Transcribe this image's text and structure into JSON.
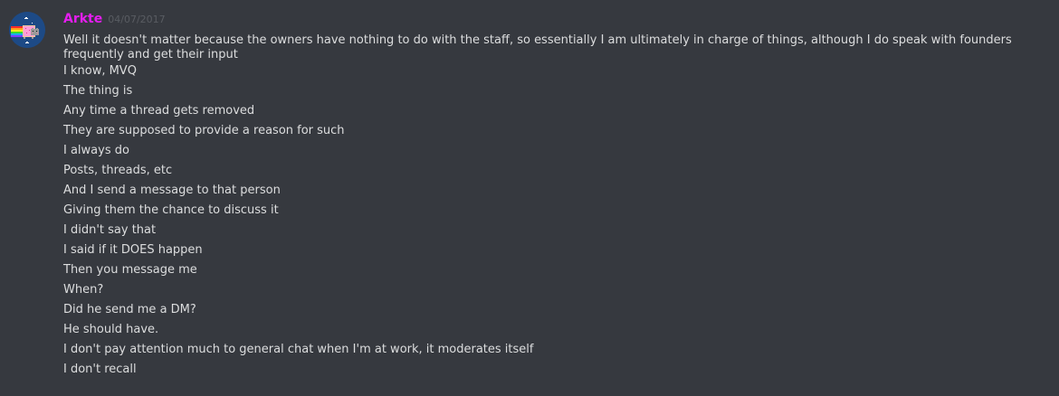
{
  "message": {
    "author": "Arkte",
    "timestamp": "04/07/2017",
    "author_color": "#e51eef",
    "avatar_icon": "nyan-cat-avatar"
  },
  "lines": [
    "Well it doesn't matter because the owners have nothing to do with the staff, so essentially I am ultimately in charge of things, although I do speak with founders frequently and get their input",
    "I know, MVQ",
    "The thing is",
    "Any time a thread gets removed",
    "They are supposed to provide a reason for such",
    "I always do",
    "Posts, threads, etc",
    "And I send a message to that person",
    "Giving them the chance to discuss it",
    "I didn't say that",
    "I said if it DOES happen",
    "Then you message me",
    "When?",
    "Did he send me a DM?",
    "He should have.",
    "I don't pay attention much to general chat when I'm at work, it moderates itself",
    "I don't recall"
  ]
}
